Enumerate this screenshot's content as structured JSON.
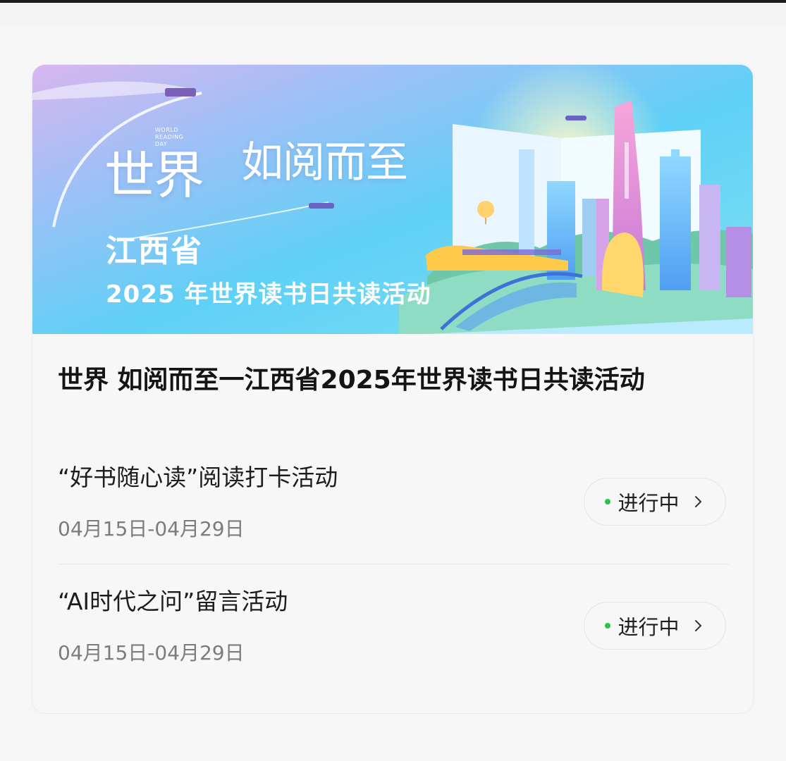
{
  "banner": {
    "line1": "世界",
    "world_reading_day": "WORLD READING DAY",
    "line1b": "如阅而至",
    "province": "江西省",
    "campaign": "2025 年世界读书日共读活动"
  },
  "card": {
    "title": "世界 如阅而至一江西省2025年世界读书日共读活动"
  },
  "activities": [
    {
      "name": "“好书随心读”阅读打卡活动",
      "date": "04月15日-04月29日",
      "status": "进行中"
    },
    {
      "name": "“AI时代之问”留言活动",
      "date": "04月15日-04月29日",
      "status": "进行中"
    }
  ],
  "colors": {
    "status_dot": "#2fbf4f",
    "title": "#141414",
    "date": "#7c7c7c"
  }
}
